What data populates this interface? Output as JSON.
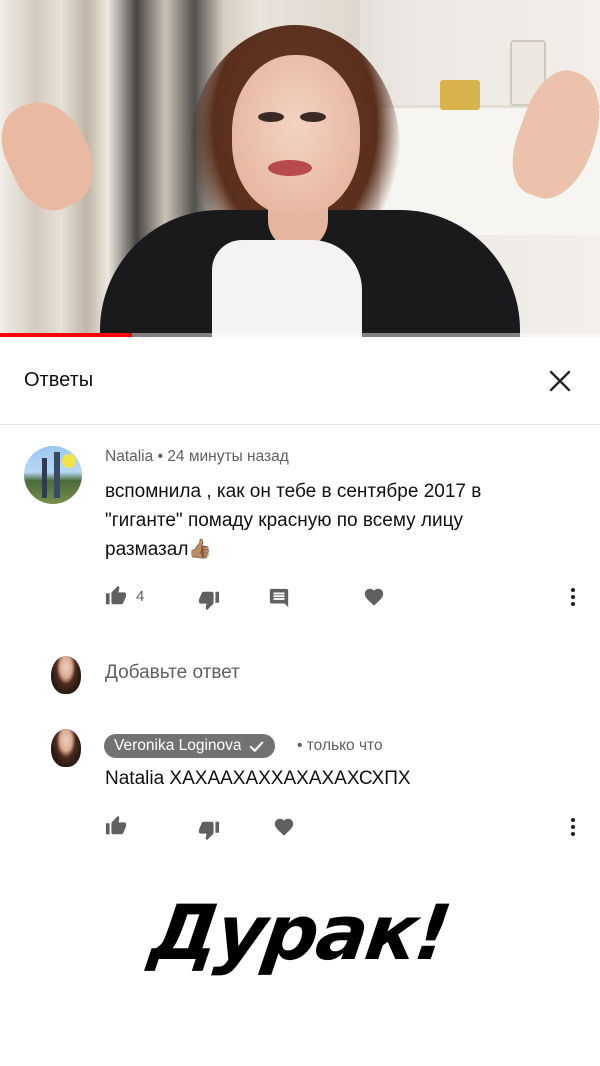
{
  "video": {
    "progress_fraction": 0.22
  },
  "replies_panel": {
    "title": "Ответы",
    "close_icon": "close-icon"
  },
  "comment": {
    "author": "Natalia",
    "separator": "•",
    "time": "24 минуты назад",
    "text_line1": "вспомнила , как он тебе в сентябре 2017 в",
    "text_line2": "\"гиганте\" помаду красную по всему лицу",
    "text_line3": "размазал👍🏽",
    "like_count": "4"
  },
  "add_reply": {
    "placeholder": "Добавьте ответ"
  },
  "reply": {
    "author": "Veronika Loginova",
    "verified": true,
    "separator": "•",
    "time": "только что",
    "text": "Natalia ХАХААХАХХАХАХАХСХПХ"
  },
  "overlay": {
    "caption": "Дурак!"
  },
  "colors": {
    "progress": "#ff0000",
    "badge_bg": "#727272",
    "meta_text": "#606060",
    "icon": "#606060"
  }
}
